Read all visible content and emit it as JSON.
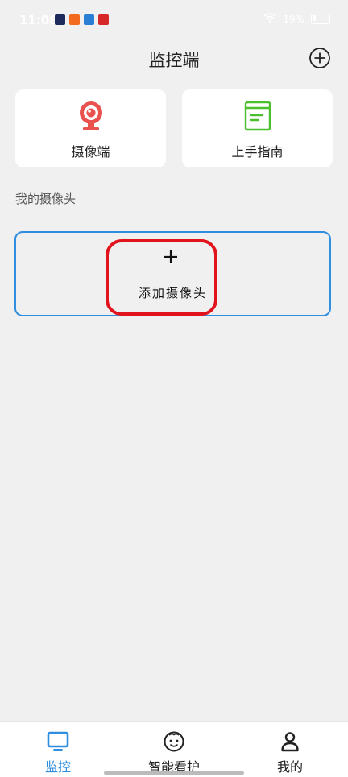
{
  "status_bar": {
    "time": "11:08",
    "battery": "19%"
  },
  "header": {
    "title": "监控端"
  },
  "cards": [
    {
      "label": "摄像端",
      "icon": "webcam-icon"
    },
    {
      "label": "上手指南",
      "icon": "guide-book-icon"
    }
  ],
  "section": {
    "label": "我的摄像头"
  },
  "camera_box": {
    "add_label": "添加摄像头"
  },
  "tabs": [
    {
      "label": "监控",
      "icon": "monitor-icon",
      "active": true
    },
    {
      "label": "智能看护",
      "icon": "baby-face-icon",
      "active": false
    },
    {
      "label": "我的",
      "icon": "person-icon",
      "active": false
    }
  ],
  "colors": {
    "accent": "#2f8ee0",
    "highlight": "#e1131c",
    "camera_icon": "#e9524f",
    "guide_icon": "#4cbf2e"
  }
}
